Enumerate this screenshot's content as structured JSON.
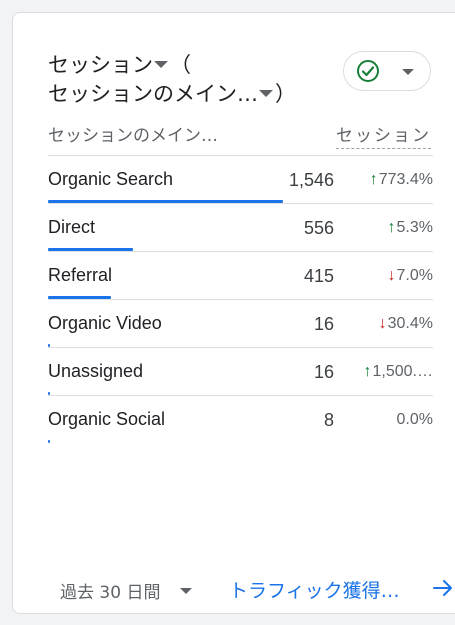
{
  "title": {
    "line1": "セッション",
    "paren_open": "（",
    "line2": "セッションのメイン…",
    "paren_close": "）"
  },
  "status_button": {
    "icon": "check-circle-icon",
    "status_color": "#188038"
  },
  "table": {
    "dimension_header": "セッションのメイン…",
    "metric_header": "セッション",
    "rows": [
      {
        "name": "Organic Search",
        "value": "1,546",
        "change": "773.4%",
        "direction": "up",
        "share": 1.0
      },
      {
        "name": "Direct",
        "value": "556",
        "change": "5.3%",
        "direction": "up",
        "share": 0.36
      },
      {
        "name": "Referral",
        "value": "415",
        "change": "7.0%",
        "direction": "down",
        "share": 0.27
      },
      {
        "name": "Organic Video",
        "value": "16",
        "change": "30.4%",
        "direction": "down",
        "share": 0.01
      },
      {
        "name": "Unassigned",
        "value": "16",
        "change": "1,500.…",
        "direction": "up",
        "share": 0.01
      },
      {
        "name": "Organic Social",
        "value": "8",
        "change": "0.0%",
        "direction": "none",
        "share": 0.005
      }
    ]
  },
  "footer": {
    "date_range": "過去 30 日間",
    "link_label": "トラフィック獲得…",
    "link_icon": "arrow-right-icon"
  },
  "colors": {
    "accent": "#1a73e8",
    "up": "#188038",
    "down": "#c5221f"
  }
}
